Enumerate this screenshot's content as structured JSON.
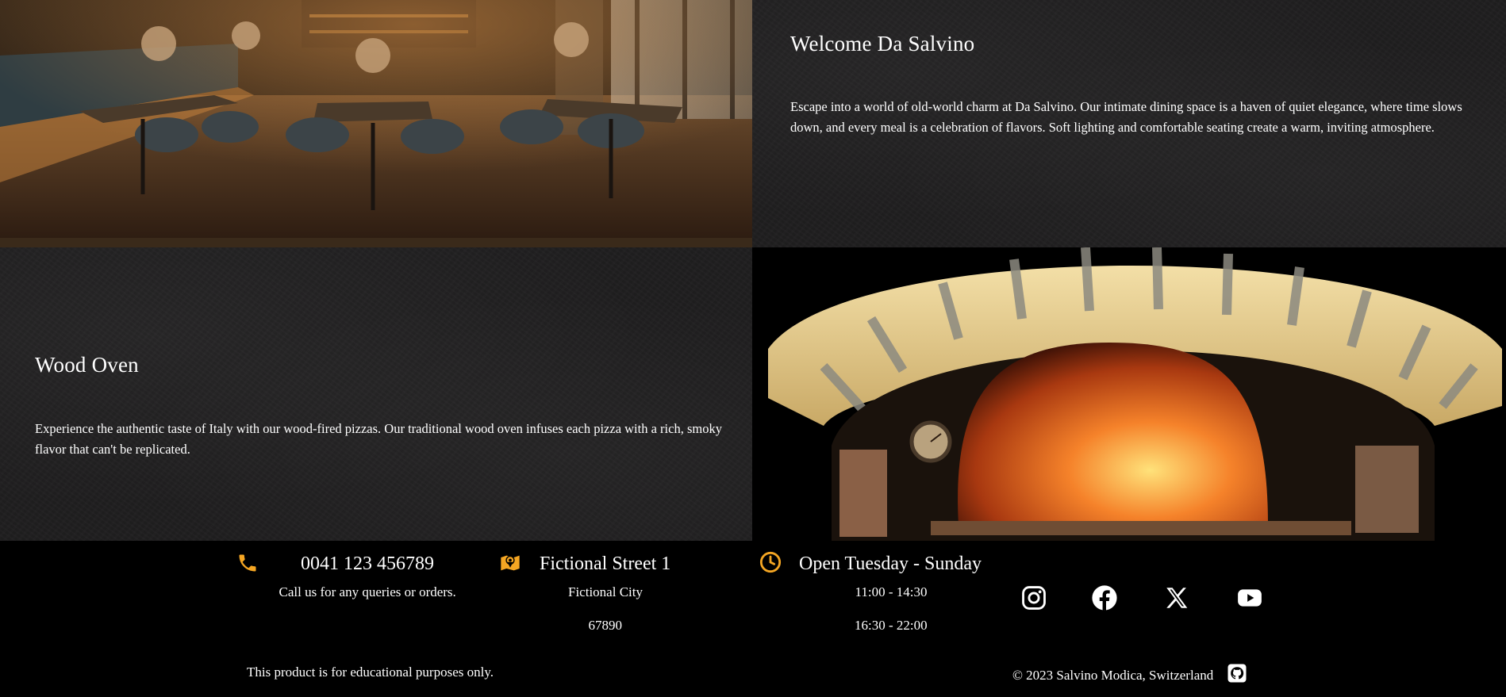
{
  "welcome": {
    "title": "Welcome Da Salvino",
    "text": "Escape into a world of old-world charm at Da Salvino. Our intimate dining space is a haven of quiet elegance, where time slows down, and every meal is a celebration of flavors. Soft lighting and comfortable seating create a warm, inviting atmosphere."
  },
  "wood_oven": {
    "title": "Wood Oven",
    "text": "Experience the authentic taste of Italy with our wood-fired pizzas. Our traditional wood oven infuses each pizza with a rich, smoky flavor that can't be replicated."
  },
  "footer": {
    "phone": {
      "icon": "phone-icon",
      "number": "0041 123 456789",
      "note": "Call us for any queries or orders."
    },
    "address": {
      "icon": "map-icon",
      "street": "Fictional Street 1",
      "city": "Fictional City",
      "zip": "67890"
    },
    "hours": {
      "icon": "clock-icon",
      "title": "Open Tuesday - Sunday",
      "lunch": "11:00 - 14:30",
      "dinner": "16:30 - 22:00"
    },
    "social": [
      "instagram-icon",
      "facebook-icon",
      "x-icon",
      "youtube-icon"
    ],
    "disclaimer": "This product is for educational purposes only.",
    "copyright": "© 2023 Salvino Modica, Switzerland",
    "github_icon": "github-icon"
  },
  "colors": {
    "accent": "#f5a623",
    "text": "#ffffff",
    "panel": "#1f1e1f",
    "background": "#000000"
  }
}
